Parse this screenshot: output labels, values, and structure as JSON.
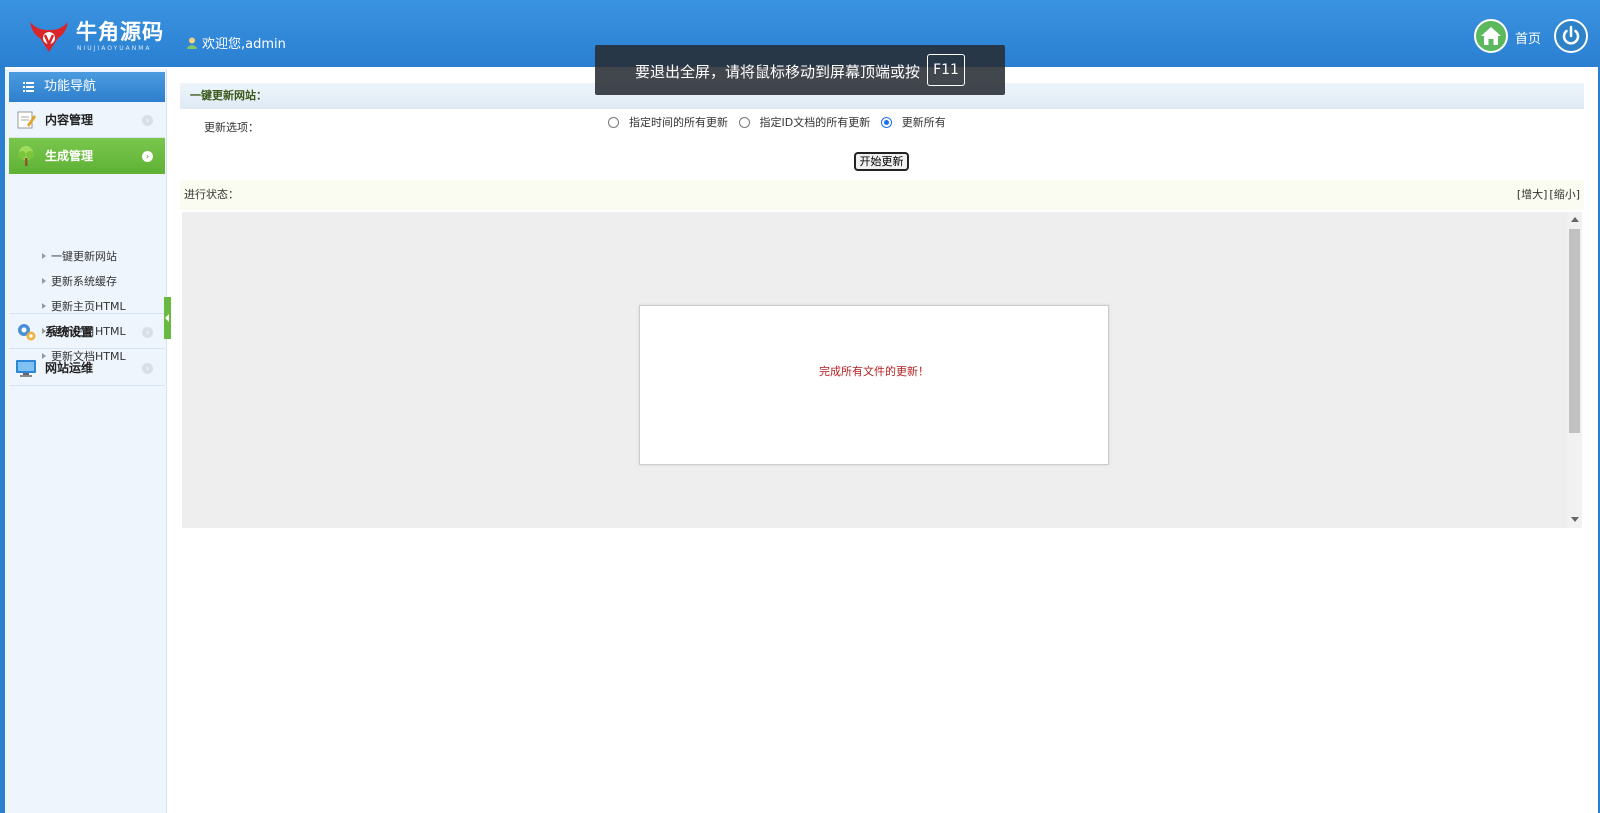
{
  "header": {
    "logo_text": "牛角源码",
    "logo_sub": "NIUJIAOYUANMA",
    "welcome": "欢迎您,admin",
    "home_label": "首页"
  },
  "toast": {
    "text": "要退出全屏，请将鼠标移动到屏幕顶端或按",
    "key": "F11"
  },
  "sidebar": {
    "title": "功能导航",
    "items": [
      {
        "label": "内容管理",
        "icon": "edit-icon"
      },
      {
        "label": "生成管理",
        "icon": "tree-icon",
        "active": true
      },
      {
        "label": "系统设置",
        "icon": "gears-icon"
      },
      {
        "label": "网站运维",
        "icon": "monitor-icon"
      }
    ],
    "sub_items": [
      "一键更新网站",
      "更新系统缓存",
      "更新主页HTML",
      "更新栏目HTML",
      "更新文档HTML"
    ]
  },
  "main": {
    "section_title": "一键更新网站：",
    "options_label": "更新选项：",
    "options": [
      {
        "label": "指定时间的所有更新",
        "checked": false
      },
      {
        "label": "指定ID文档的所有更新",
        "checked": false
      },
      {
        "label": "更新所有",
        "checked": true
      }
    ],
    "start_button": "开始更新",
    "status_label": "进行状态：",
    "enlarge": "[增大]",
    "shrink": "[缩小]",
    "message": "完成所有文件的更新！"
  },
  "colors": {
    "header_blue": "#2a7fd1",
    "active_green": "#5eb236",
    "message_red": "#b22222"
  }
}
